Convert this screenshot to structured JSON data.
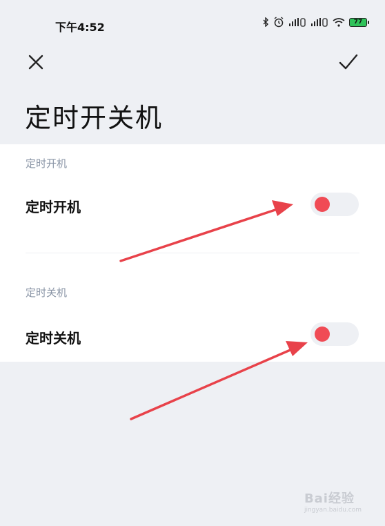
{
  "status_bar": {
    "time": "下午4:52",
    "battery_level": "77",
    "icons": [
      "bluetooth-icon",
      "alarm-icon",
      "signal-icon",
      "signal-icon",
      "wifi-icon",
      "battery-icon"
    ]
  },
  "header": {
    "close_icon": "close-icon",
    "confirm_icon": "check-icon",
    "title": "定时开关机"
  },
  "sections": [
    {
      "label": "定时开机",
      "item_label": "定时开机",
      "toggle_state": "off"
    },
    {
      "label": "定时关机",
      "item_label": "定时关机",
      "toggle_state": "off"
    }
  ],
  "annotations": {
    "arrow_color": "#e8424a"
  },
  "watermark": {
    "brand": "Bai",
    "brand_suffix": "经验",
    "url": "jingyan.baidu.com"
  },
  "colors": {
    "background": "#eef0f4",
    "card": "#ffffff",
    "toggle_knob": "#f04b55",
    "section_label": "#8a95a6"
  }
}
